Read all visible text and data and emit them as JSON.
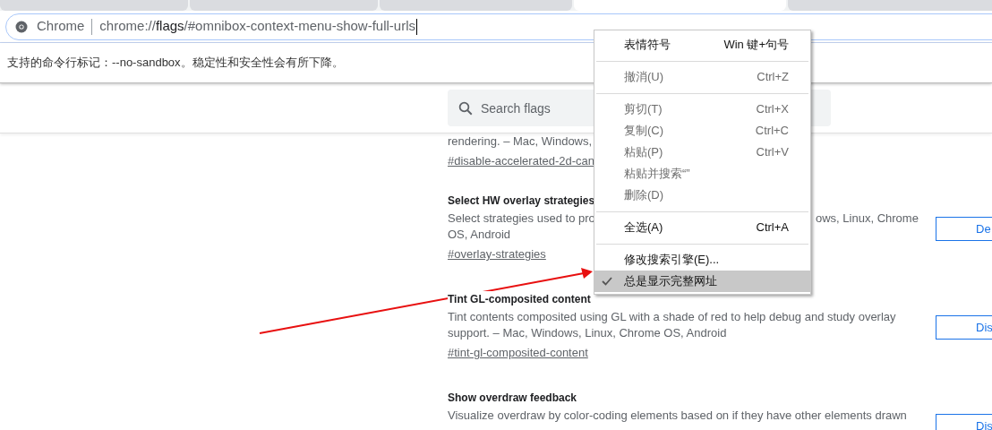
{
  "tabs": [
    {
      "selected": false
    },
    {
      "selected": false
    },
    {
      "selected": false
    },
    {
      "selected": true
    },
    {
      "selected": false
    }
  ],
  "omnibox": {
    "site_label": "Chrome",
    "url_scheme": "chrome://",
    "url_host": "flags",
    "url_path": "/#omnibox-context-menu-show-full-urls"
  },
  "infobar": {
    "text": "支持的命令行标记：--no-sandbox。稳定性和安全性会有所下降。"
  },
  "search": {
    "placeholder": "Search flags"
  },
  "flags": [
    {
      "description": [
        {
          "left": "rendering. – Mac, Windows,"
        }
      ],
      "link": "#disable-accelerated-2d-can"
    },
    {
      "title": "Select HW overlay strategies",
      "description": [
        {
          "left": "Select strategies used to pro",
          "right": "ows, Linux, Chrome"
        },
        {
          "left": "OS, Android"
        }
      ],
      "link": "#overlay-strategies",
      "button": "De"
    },
    {
      "title": "Tint GL-composited content",
      "description": [
        {
          "left": "Tint contents composited using GL with a shade of red to help debug and study overlay"
        },
        {
          "left": "support. – Mac, Windows, Linux, Chrome OS, Android"
        }
      ],
      "link": "#tint-gl-composited-content",
      "button": "Dis"
    },
    {
      "title": "Show overdraw feedback",
      "description": [
        {
          "left": "Visualize overdraw by color-coding elements based on if they have other elements drawn"
        }
      ],
      "button": "Dis"
    }
  ],
  "context_menu": [
    {
      "kind": "item",
      "label": "表情符号",
      "shortcut": "Win 键+句号",
      "disabled": false,
      "checked": false,
      "selected": false
    },
    {
      "kind": "separator"
    },
    {
      "kind": "item",
      "label": "撤消(U)",
      "shortcut": "Ctrl+Z",
      "disabled": true,
      "checked": false,
      "selected": false
    },
    {
      "kind": "separator"
    },
    {
      "kind": "item",
      "label": "剪切(T)",
      "shortcut": "Ctrl+X",
      "disabled": true,
      "checked": false,
      "selected": false
    },
    {
      "kind": "item",
      "label": "复制(C)",
      "shortcut": "Ctrl+C",
      "disabled": true,
      "checked": false,
      "selected": false
    },
    {
      "kind": "item",
      "label": "粘贴(P)",
      "shortcut": "Ctrl+V",
      "disabled": true,
      "checked": false,
      "selected": false
    },
    {
      "kind": "item",
      "label": "粘贴并搜索“”",
      "disabled": true,
      "checked": false,
      "selected": false
    },
    {
      "kind": "item",
      "label": "删除(D)",
      "disabled": true,
      "checked": false,
      "selected": false
    },
    {
      "kind": "separator"
    },
    {
      "kind": "item",
      "label": "全选(A)",
      "shortcut": "Ctrl+A",
      "disabled": false,
      "checked": false,
      "selected": false
    },
    {
      "kind": "separator"
    },
    {
      "kind": "item",
      "label": "修改搜索引擎(E)...",
      "disabled": false,
      "checked": false,
      "selected": false
    },
    {
      "kind": "item",
      "label": "总是显示完整网址",
      "disabled": false,
      "checked": true,
      "selected": true
    }
  ]
}
